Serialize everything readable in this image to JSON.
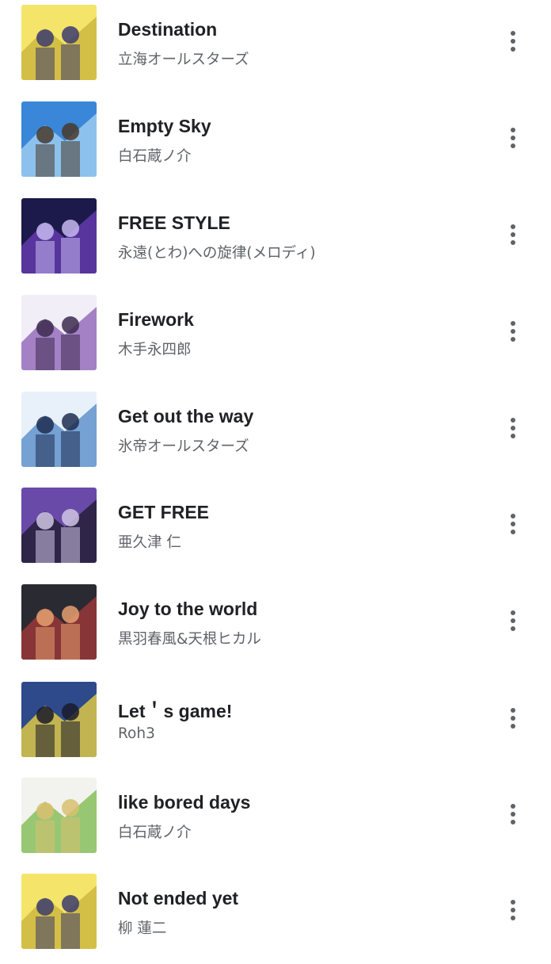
{
  "tracks": [
    {
      "title": "Destination",
      "artist": "立海オールスターズ",
      "art_icon": "rikkai-super-stars-album-art",
      "art_colors": [
        "#f4e56a",
        "#c9b23b",
        "#3b3b6e"
      ]
    },
    {
      "title": "Empty Sky",
      "artist": "白石蔵ノ介",
      "art_icon": "empty-sky-album-art",
      "art_colors": [
        "#3a86d8",
        "#a9d4f4",
        "#4a3a2a"
      ]
    },
    {
      "title": "FREE STYLE",
      "artist": "永遠(とわ)への旋律(メロディ)",
      "art_icon": "free-style-album-art",
      "art_colors": [
        "#1c1a4a",
        "#6b3fb8",
        "#c6b8f0"
      ]
    },
    {
      "title": "Firework",
      "artist": "木手永四郎",
      "art_icon": "higa-super-stars-album-art",
      "art_colors": [
        "#f2eef8",
        "#8a5cb4",
        "#3c2a4e"
      ]
    },
    {
      "title": "Get out the way",
      "artist": "氷帝オールスターズ",
      "art_icon": "hyotei-super-stars-album-art",
      "art_colors": [
        "#e8f1fa",
        "#4f86c6",
        "#1e2e50"
      ]
    },
    {
      "title": "GET FREE",
      "artist": "亜久津 仁",
      "art_icon": "get-free-album-art",
      "art_colors": [
        "#6a4aa8",
        "#1c1a2a",
        "#cfc6e4"
      ]
    },
    {
      "title": "Joy to the world",
      "artist": "黒羽春風&天根ヒカル",
      "art_icon": "joy-to-the-world-album-art",
      "art_colors": [
        "#2a2a32",
        "#a83a3a",
        "#e6a070"
      ]
    },
    {
      "title": "Let＇s game!",
      "artist": "Roh3",
      "art_icon": "rohring-album-art",
      "art_colors": [
        "#2f4a8a",
        "#f4d83c",
        "#1a1a2a"
      ]
    },
    {
      "title": "like bored days",
      "artist": "白石蔵ノ介",
      "art_icon": "like-bored-days-album-art",
      "art_colors": [
        "#f2f2ee",
        "#7ab84a",
        "#d8c070"
      ]
    },
    {
      "title": "Not ended yet",
      "artist": "柳 蓮二",
      "art_icon": "rikkai-super-stars-album-art",
      "art_colors": [
        "#f4e56a",
        "#c9b23b",
        "#3b3b6e"
      ]
    }
  ],
  "more_icon": "more-vert-icon"
}
